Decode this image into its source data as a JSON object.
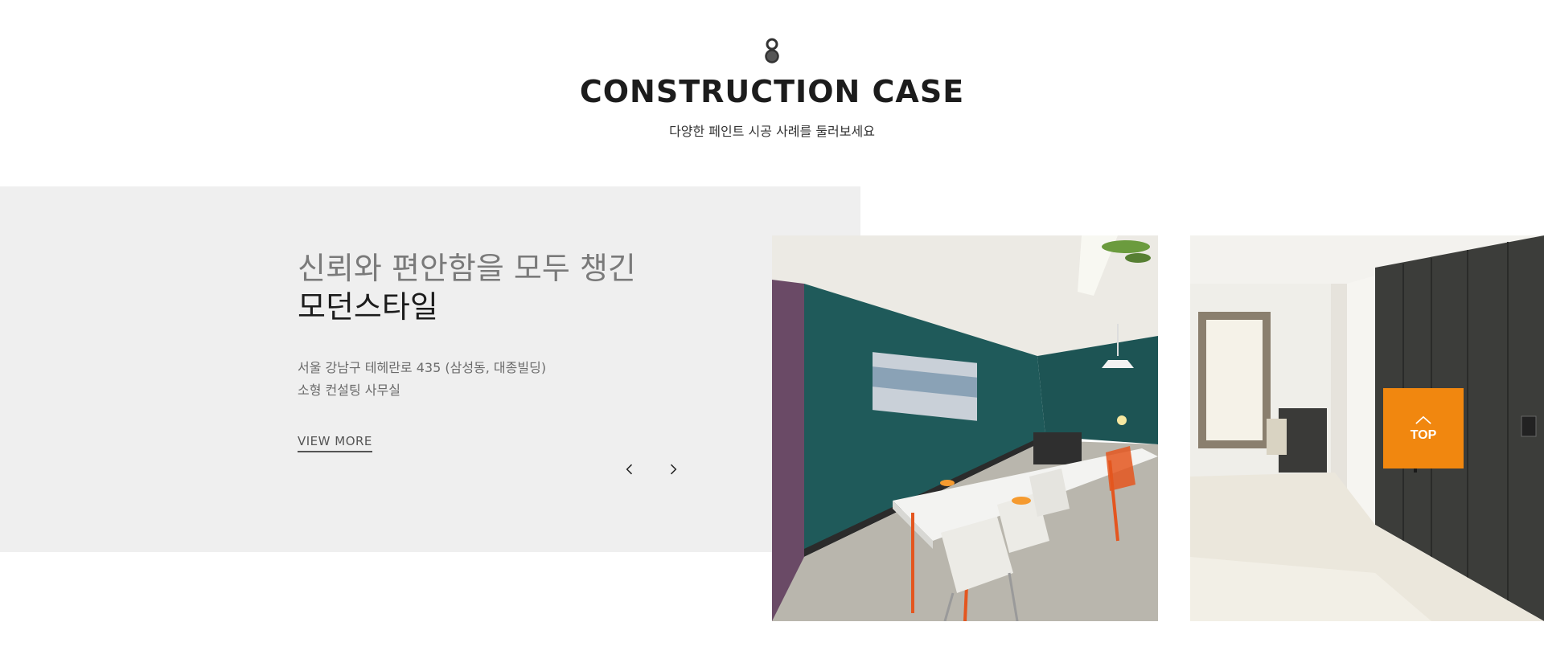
{
  "section": {
    "icon": "paint-drop-icon",
    "title": "CONSTRUCTION CASE",
    "subtitle": "다양한 페인트 시공 사례를 둘러보세요"
  },
  "case": {
    "headline_line1": "신뢰와 편안함을 모두 챙긴",
    "headline_line2": "모던스타일",
    "address_line1": "서울 강남구 테헤란로 435 (삼성동, 대종빌딩)",
    "address_line2": "소형 컨설팅 사무실",
    "view_more": "VIEW MORE"
  },
  "slider": {
    "prev_icon": "chevron-left-icon",
    "next_icon": "chevron-right-icon"
  },
  "photos": [
    {
      "subject": "office-meeting-room-teal-wall"
    },
    {
      "subject": "hallway-dark-gray-wardrobe"
    }
  ],
  "top_button": {
    "icon": "chevron-up-icon",
    "label": "TOP"
  },
  "colors": {
    "accent": "#f1870f",
    "panel_bg": "#efefef",
    "title": "#1c1c1c",
    "text_muted": "#6b6b6b",
    "teal_wall": "#1f5a5a",
    "wardrobe": "#3c3d3a"
  }
}
